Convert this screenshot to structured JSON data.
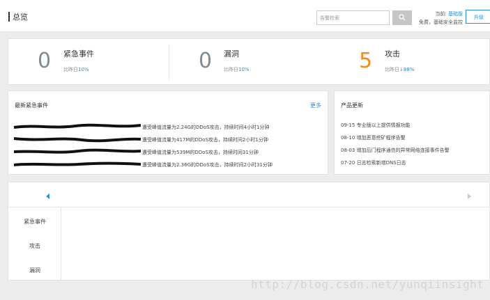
{
  "header": {
    "title": "总览",
    "search_placeholder": "告警检索",
    "current_label": "当前:",
    "current_level": "基础版",
    "current_desc": "免费，基础安全监控",
    "upgrade_label": "升级"
  },
  "stats": [
    {
      "value": "0",
      "label": "紧急事件",
      "cmp_prefix": "比昨日",
      "cmp_value": "10%"
    },
    {
      "value": "0",
      "label": "漏洞",
      "cmp_prefix": "比昨日",
      "cmp_value": "10%"
    },
    {
      "value": "5",
      "label": "攻击",
      "cmp_prefix": "比昨日",
      "cmp_value": "↓88%"
    }
  ],
  "events": {
    "title": "最新紧急事件",
    "more": "更多",
    "rows": [
      "遭受峰值流量为2.24G的DDoS攻击，持续时间4小时1分钟",
      "遭受峰值流量为417M的DDoS攻击，持续时间2小时1分钟",
      "遭受峰值流量为539M的DDoS攻击，持续时间31分钟",
      "遭受峰值流量为2.36G的DDoS攻击，持续时间2小时31分钟"
    ]
  },
  "updates": {
    "title": "产品更新",
    "rows": [
      "09-15 专业版以上提供情报功能",
      "08-10 增加恶意挖矿程序告警",
      "08-03 增加后门程序通信的异常网络连接事件告警",
      "07-20 日志检索新增DNS日志"
    ]
  },
  "side_tabs": [
    "紧急事件",
    "攻击",
    "漏洞"
  ],
  "watermark": "http://blog.csdn.net/yunqiinsight"
}
